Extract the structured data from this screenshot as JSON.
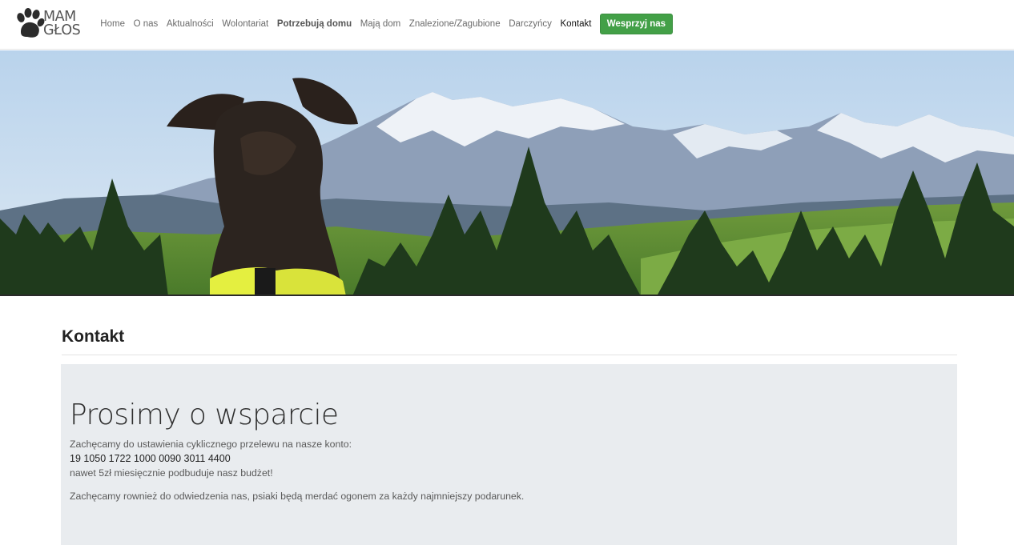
{
  "brand": {
    "line1": "MAM",
    "line2": "GŁOS"
  },
  "nav": {
    "items": [
      {
        "label": "Home"
      },
      {
        "label": "O nas"
      },
      {
        "label": "Aktualności"
      },
      {
        "label": "Wolontariat"
      },
      {
        "label": "Potrzebują domu"
      },
      {
        "label": "Mają dom"
      },
      {
        "label": "Znalezione/Zagubione"
      },
      {
        "label": "Darczyńcy"
      },
      {
        "label": "Kontakt"
      }
    ],
    "cta_label": "Wesprzyj nas"
  },
  "colors": {
    "cta_green": "#43a047",
    "jumbotron_bg": "#e9ecef"
  },
  "hero": {
    "icon": "dog-mountains-photo"
  },
  "page": {
    "title": "Kontakt"
  },
  "support": {
    "heading": "Prosimy o wsparcie",
    "intro": "Zachęcamy do ustawienia cyklicznego przelewu na nasze konto:",
    "account": "19 1050 1722 1000 0090 3011 4400",
    "note": "nawet 5zł miesięcznie podbuduje nasz budżet!",
    "visit": "Zachęcamy rownież do odwiedzenia nas, psiaki będą merdać ogonem za każdy najmniejszy podarunek."
  }
}
